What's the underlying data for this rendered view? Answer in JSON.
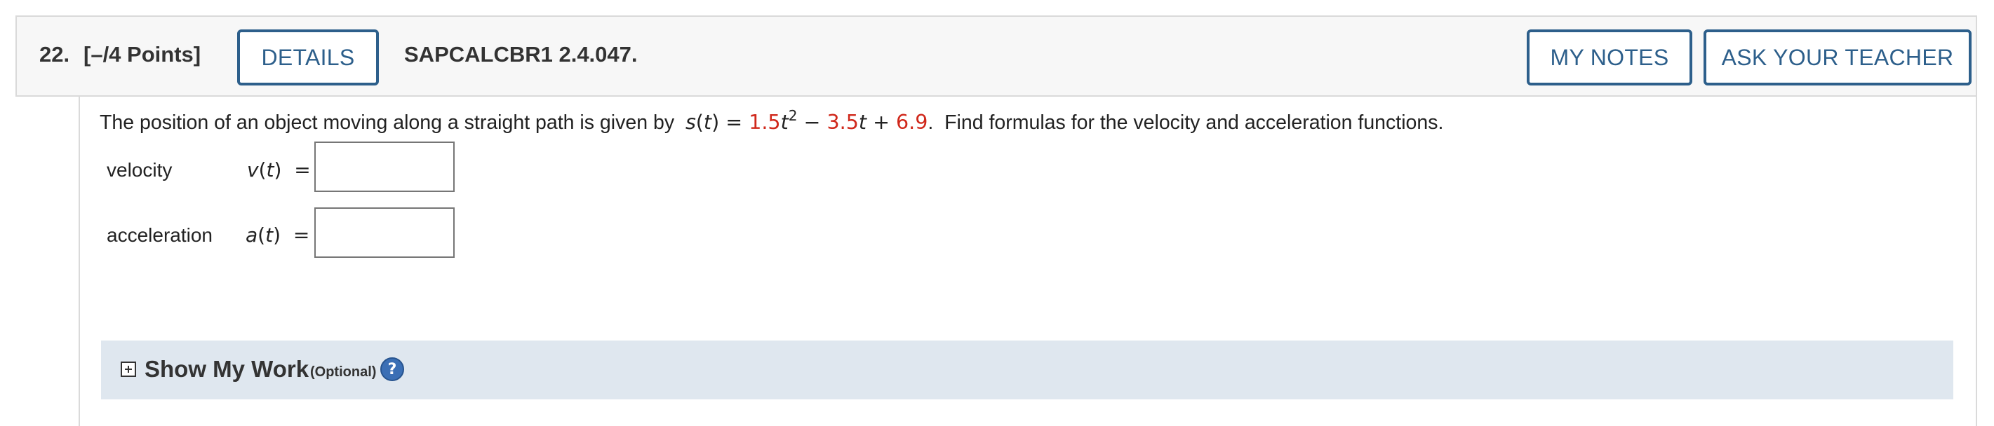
{
  "question": {
    "number": "22.",
    "points": "[–/4 Points]",
    "details_label": "DETAILS",
    "code": "SAPCALCBR1 2.4.047.",
    "my_notes_label": "MY NOTES",
    "ask_teacher_label": "ASK YOUR TEACHER"
  },
  "prompt": {
    "intro": "The position of an object moving along a straight path is given by",
    "func_name": "s",
    "var": "t",
    "coef1": "1.5",
    "exponent": "2",
    "minus": "−",
    "coef2": "3.5",
    "plus": "+",
    "constant": "6.9",
    "outro": "Find formulas for the velocity and acceleration functions."
  },
  "answers": {
    "velocity_label": "velocity",
    "velocity_func": "v",
    "velocity_value": "",
    "acceleration_label": "acceleration",
    "acceleration_func": "a",
    "acceleration_value": ""
  },
  "show_my_work": {
    "title": "Show My Work",
    "optional": "(Optional)",
    "help_glyph": "?"
  },
  "colors": {
    "accent": "#2d5f8b",
    "randomized_value": "#d0281b",
    "work_bar": "#dfe7ef"
  },
  "icons": {
    "expand": "plus-square-icon",
    "help": "question-circle-icon"
  }
}
